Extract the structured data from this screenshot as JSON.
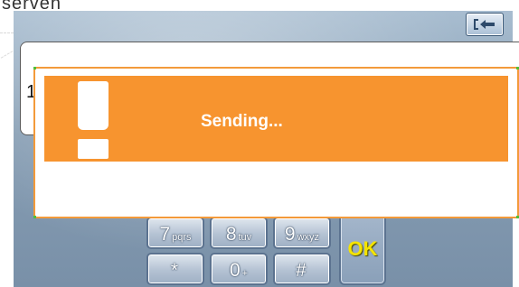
{
  "background_fragment": "serven",
  "toolbar": {
    "back_icon": "back-arrow-icon"
  },
  "phone_field": {
    "value": "1"
  },
  "keypad": {
    "keys": [
      {
        "digit": "7",
        "letters": "pqrs"
      },
      {
        "digit": "8",
        "letters": "tuv"
      },
      {
        "digit": "9",
        "letters": "wxyz"
      },
      {
        "digit": "*",
        "letters": ""
      },
      {
        "digit": "0",
        "letters": "+"
      },
      {
        "digit": "#",
        "letters": ""
      }
    ],
    "ok_label": "OK"
  },
  "dialog": {
    "icon": "exclamation-icon",
    "message": "Sending...",
    "banner_color": "#f7942f",
    "border_color": "#f39a3a"
  },
  "colors": {
    "ok_text": "#f5e400",
    "screen_top": "#a8bdd0",
    "screen_bottom": "#7990a8"
  }
}
